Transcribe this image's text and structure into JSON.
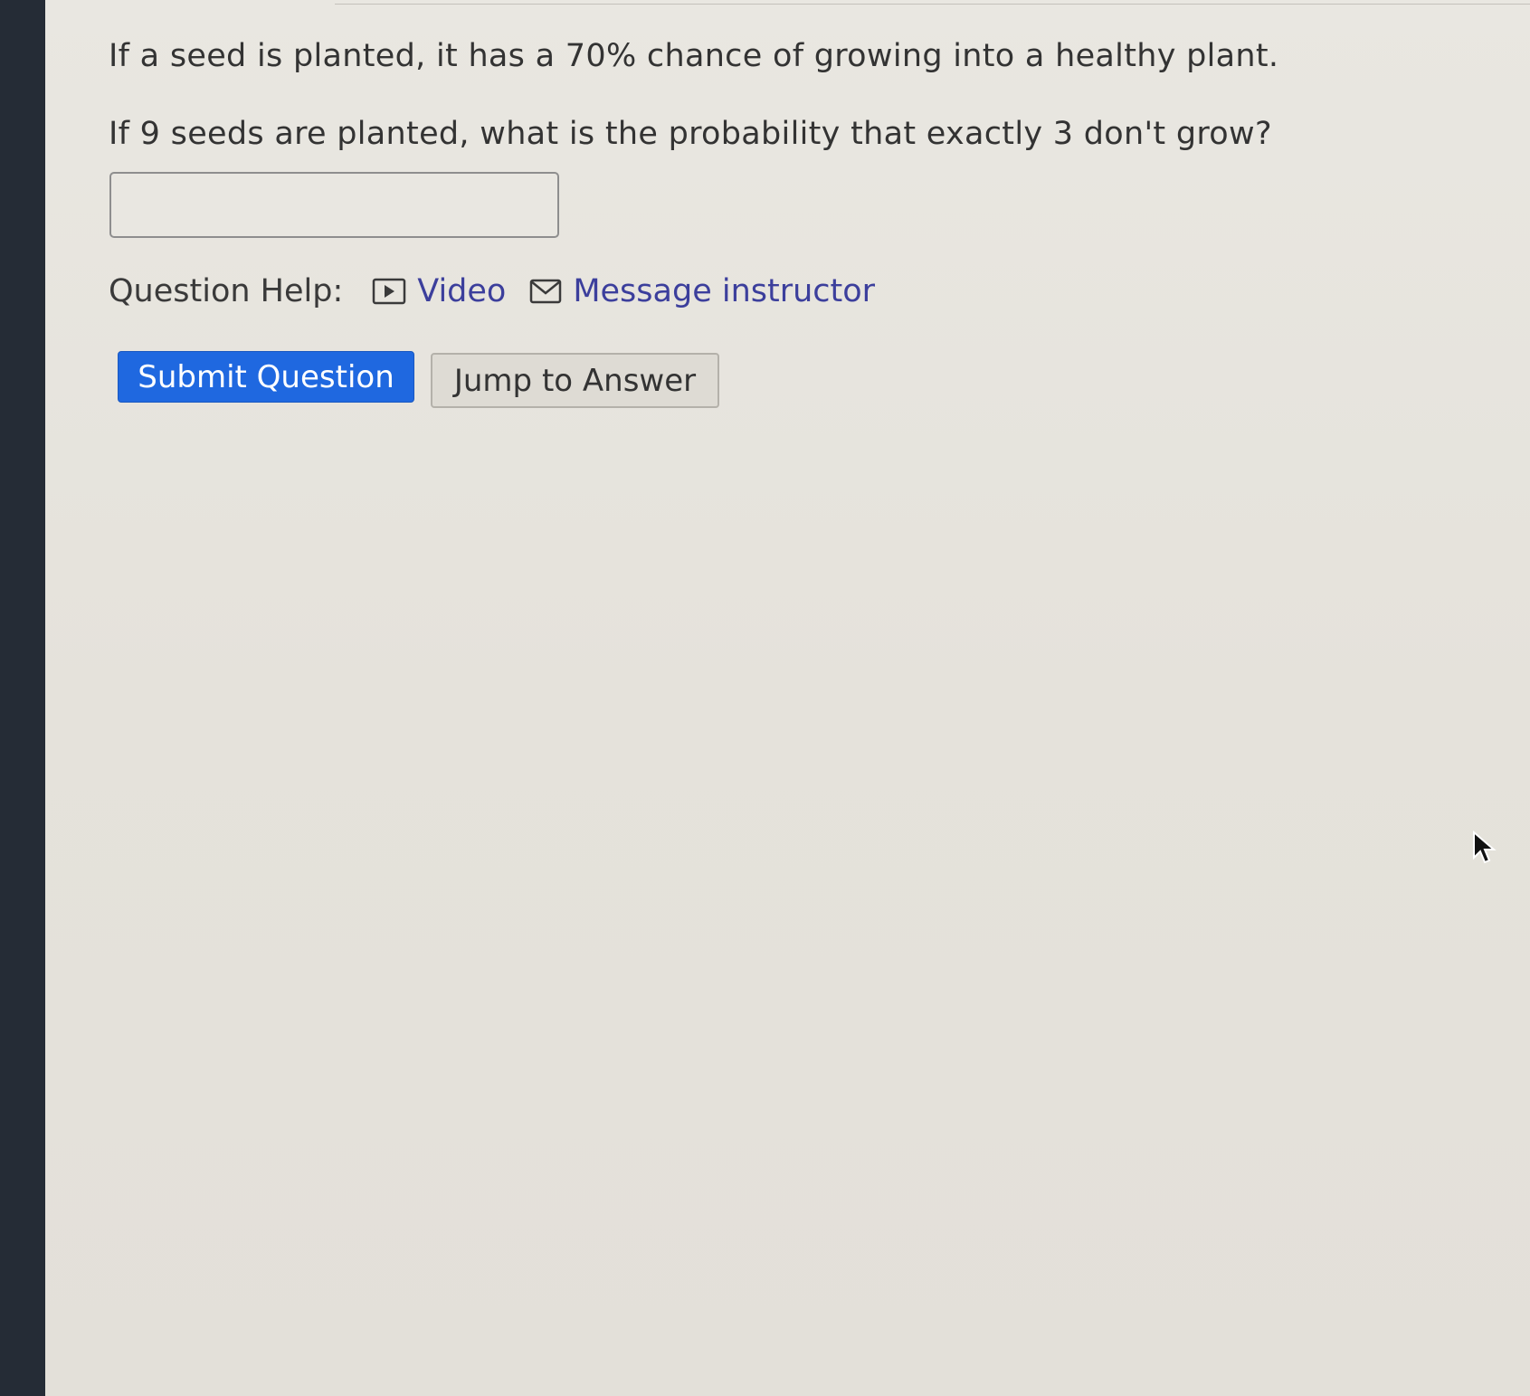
{
  "question": {
    "line1": "If a seed is planted, it has a 70% chance of growing into a healthy plant.",
    "line2": "If 9 seeds are planted, what is the probability that exactly 3 don't grow?"
  },
  "answer": {
    "value": "",
    "placeholder": ""
  },
  "help": {
    "label": "Question Help:",
    "video_label": "Video",
    "video_icon": "play-icon",
    "message_label": "Message instructor",
    "message_icon": "envelope-icon"
  },
  "buttons": {
    "submit_label": "Submit Question",
    "jump_label": "Jump to Answer"
  },
  "colors": {
    "submit_bg": "#1f68e0",
    "link": "#3c3f9c",
    "background": "#e6e3dc"
  }
}
